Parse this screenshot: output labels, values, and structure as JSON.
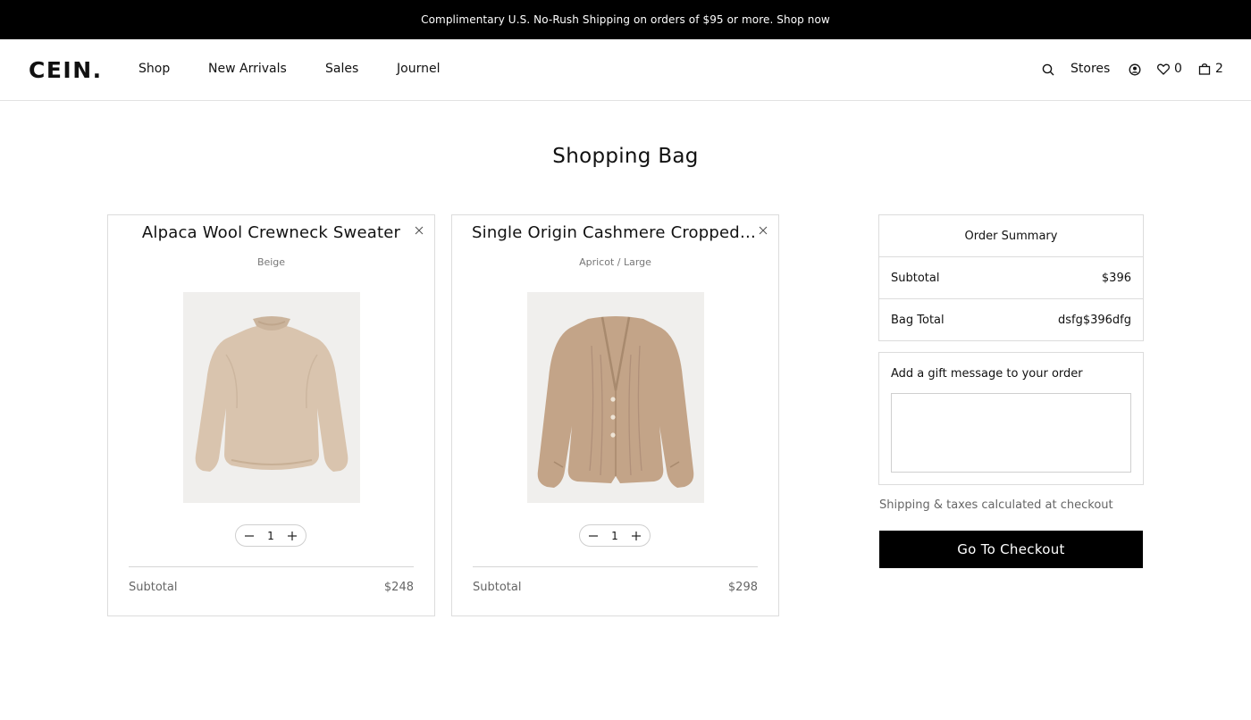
{
  "promo": {
    "text": "Complimentary U.S. No-Rush Shipping on orders of $95 or more. Shop now"
  },
  "header": {
    "logo": "CEIN.",
    "nav": [
      "Shop",
      "New Arrivals",
      "Sales",
      "Journel"
    ],
    "stores_label": "Stores",
    "wishlist_count": "0",
    "bag_count": "2",
    "icons": [
      "search-icon",
      "account-icon",
      "heart-icon",
      "bag-icon"
    ]
  },
  "page": {
    "title": "Shopping Bag"
  },
  "items": [
    {
      "name": "Alpaca Wool Crewneck Sweater",
      "variant": "Beige",
      "quantity": "1",
      "subtotal_label": "Subtotal",
      "subtotal": "$248",
      "image": "beige crewneck sweater"
    },
    {
      "name": "Single Origin Cashmere Cropped Cardigan",
      "variant": "Apricot / Large",
      "quantity": "1",
      "subtotal_label": "Subtotal",
      "subtotal": "$298",
      "image": "apricot cable-knit cardigan"
    }
  ],
  "summary": {
    "title": "Order Summary",
    "subtotal_label": "Subtotal",
    "subtotal_value": "$396",
    "total_label": "Bag Total",
    "total_value": "dsfg$396dfg"
  },
  "gift": {
    "label": "Add a gift message to your order",
    "value": ""
  },
  "shipping_note": "Shipping & taxes calculated at checkout",
  "checkout_label": "Go To Checkout",
  "colors": {
    "promo_bg": "#000000",
    "checkout_bg": "#000000",
    "border": "#dcdcdc",
    "muted_text": "#666666"
  }
}
